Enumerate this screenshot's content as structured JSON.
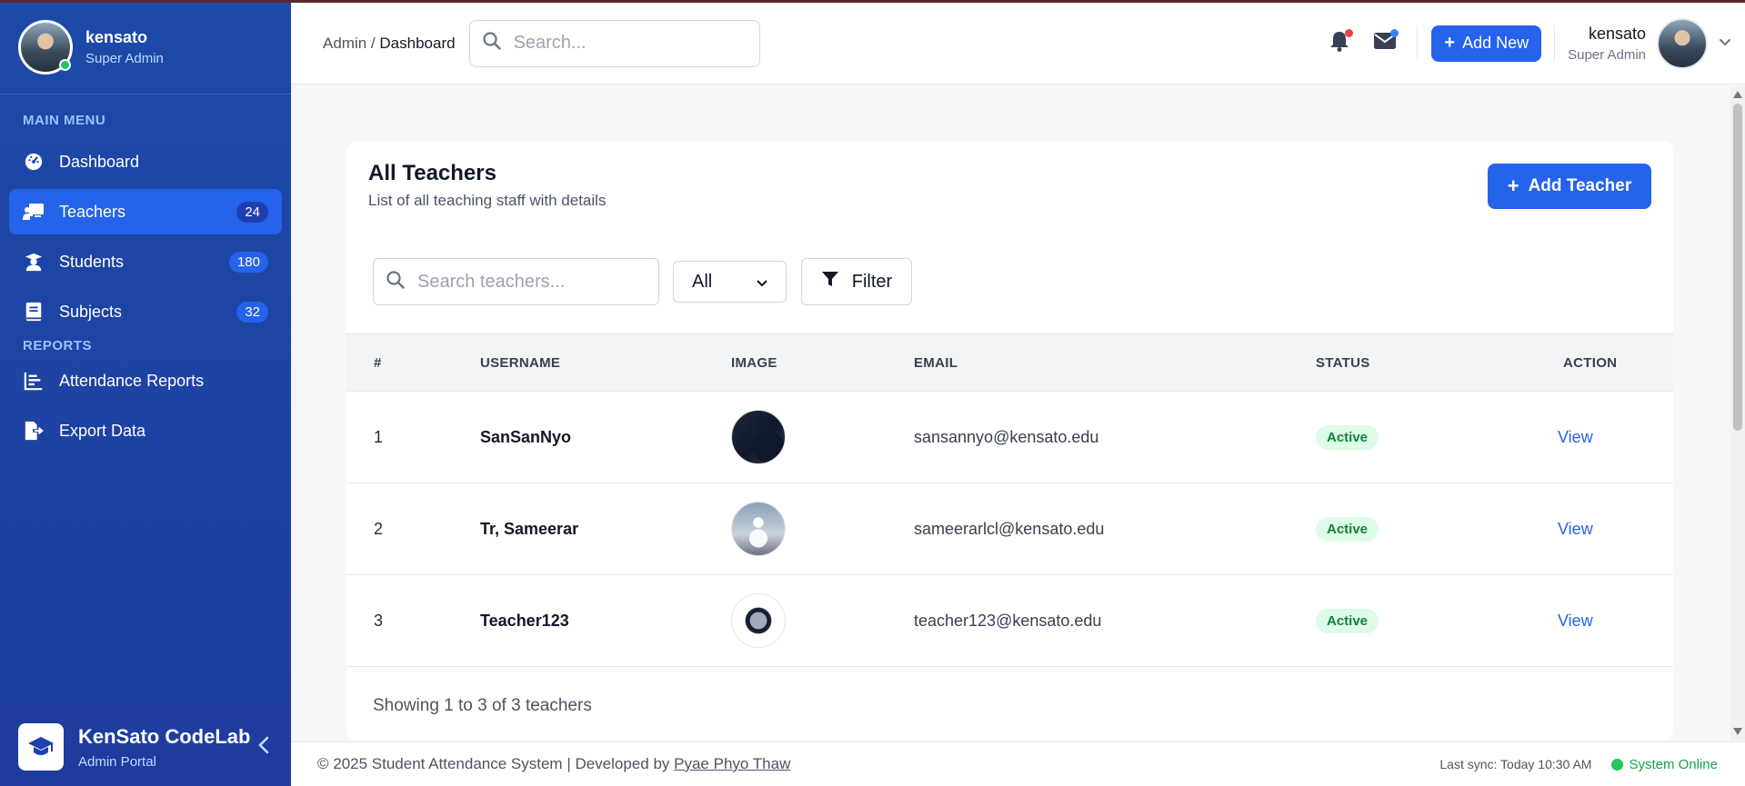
{
  "sidebar": {
    "user": {
      "name": "kensato",
      "role": "Super Admin"
    },
    "sections": {
      "main": "MAIN MENU",
      "reports": "REPORTS"
    },
    "items": [
      {
        "label": "Dashboard",
        "icon": "gauge-icon"
      },
      {
        "label": "Teachers",
        "icon": "teacher-board-icon",
        "badge": "24",
        "active": true
      },
      {
        "label": "Students",
        "icon": "graduate-icon",
        "badge": "180"
      },
      {
        "label": "Subjects",
        "icon": "book-icon",
        "badge": "32"
      },
      {
        "label": "Attendance Reports",
        "icon": "chart-icon"
      },
      {
        "label": "Export Data",
        "icon": "file-export-icon"
      }
    ],
    "brand": {
      "name": "KenSato CodeLab",
      "sub": "Admin Portal"
    }
  },
  "header": {
    "breadcrumb": {
      "root": "Admin",
      "sep": "/",
      "current": "Dashboard"
    },
    "search": {
      "placeholder": "Search..."
    },
    "add_new": "Add New",
    "user": {
      "name": "kensato",
      "role": "Super Admin"
    },
    "notif_colors": {
      "bell": "#ef4444",
      "mail": "#3b82f6"
    }
  },
  "main": {
    "title": "All Teachers",
    "subtitle": "List of all teaching staff with details",
    "add_button": "Add Teacher",
    "search_placeholder": "Search teachers...",
    "filter_select": "All",
    "filter_button": "Filter",
    "columns": [
      "#",
      "USERNAME",
      "IMAGE",
      "EMAIL",
      "STATUS",
      "ACTION"
    ],
    "rows": [
      {
        "num": "1",
        "username": "SanSanNyo",
        "email": "sansannyo@kensato.edu",
        "status": "Active",
        "action": "View"
      },
      {
        "num": "2",
        "username": "Tr, Sameerar",
        "email": "sameerarlcl@kensato.edu",
        "status": "Active",
        "action": "View"
      },
      {
        "num": "3",
        "username": "Teacher123",
        "email": "teacher123@kensato.edu",
        "status": "Active",
        "action": "View"
      }
    ],
    "showing": "Showing 1 to 3 of 3 teachers"
  },
  "footer": {
    "copyright": "© 2025 Student Attendance System | Developed by ",
    "developer": "Pyae Phyo Thaw",
    "sync": "Last sync: Today 10:30 AM",
    "status": "System Online"
  },
  "colors": {
    "accent": "#2563eb",
    "sidebar": "#1e40af",
    "online": "#22c55e"
  }
}
